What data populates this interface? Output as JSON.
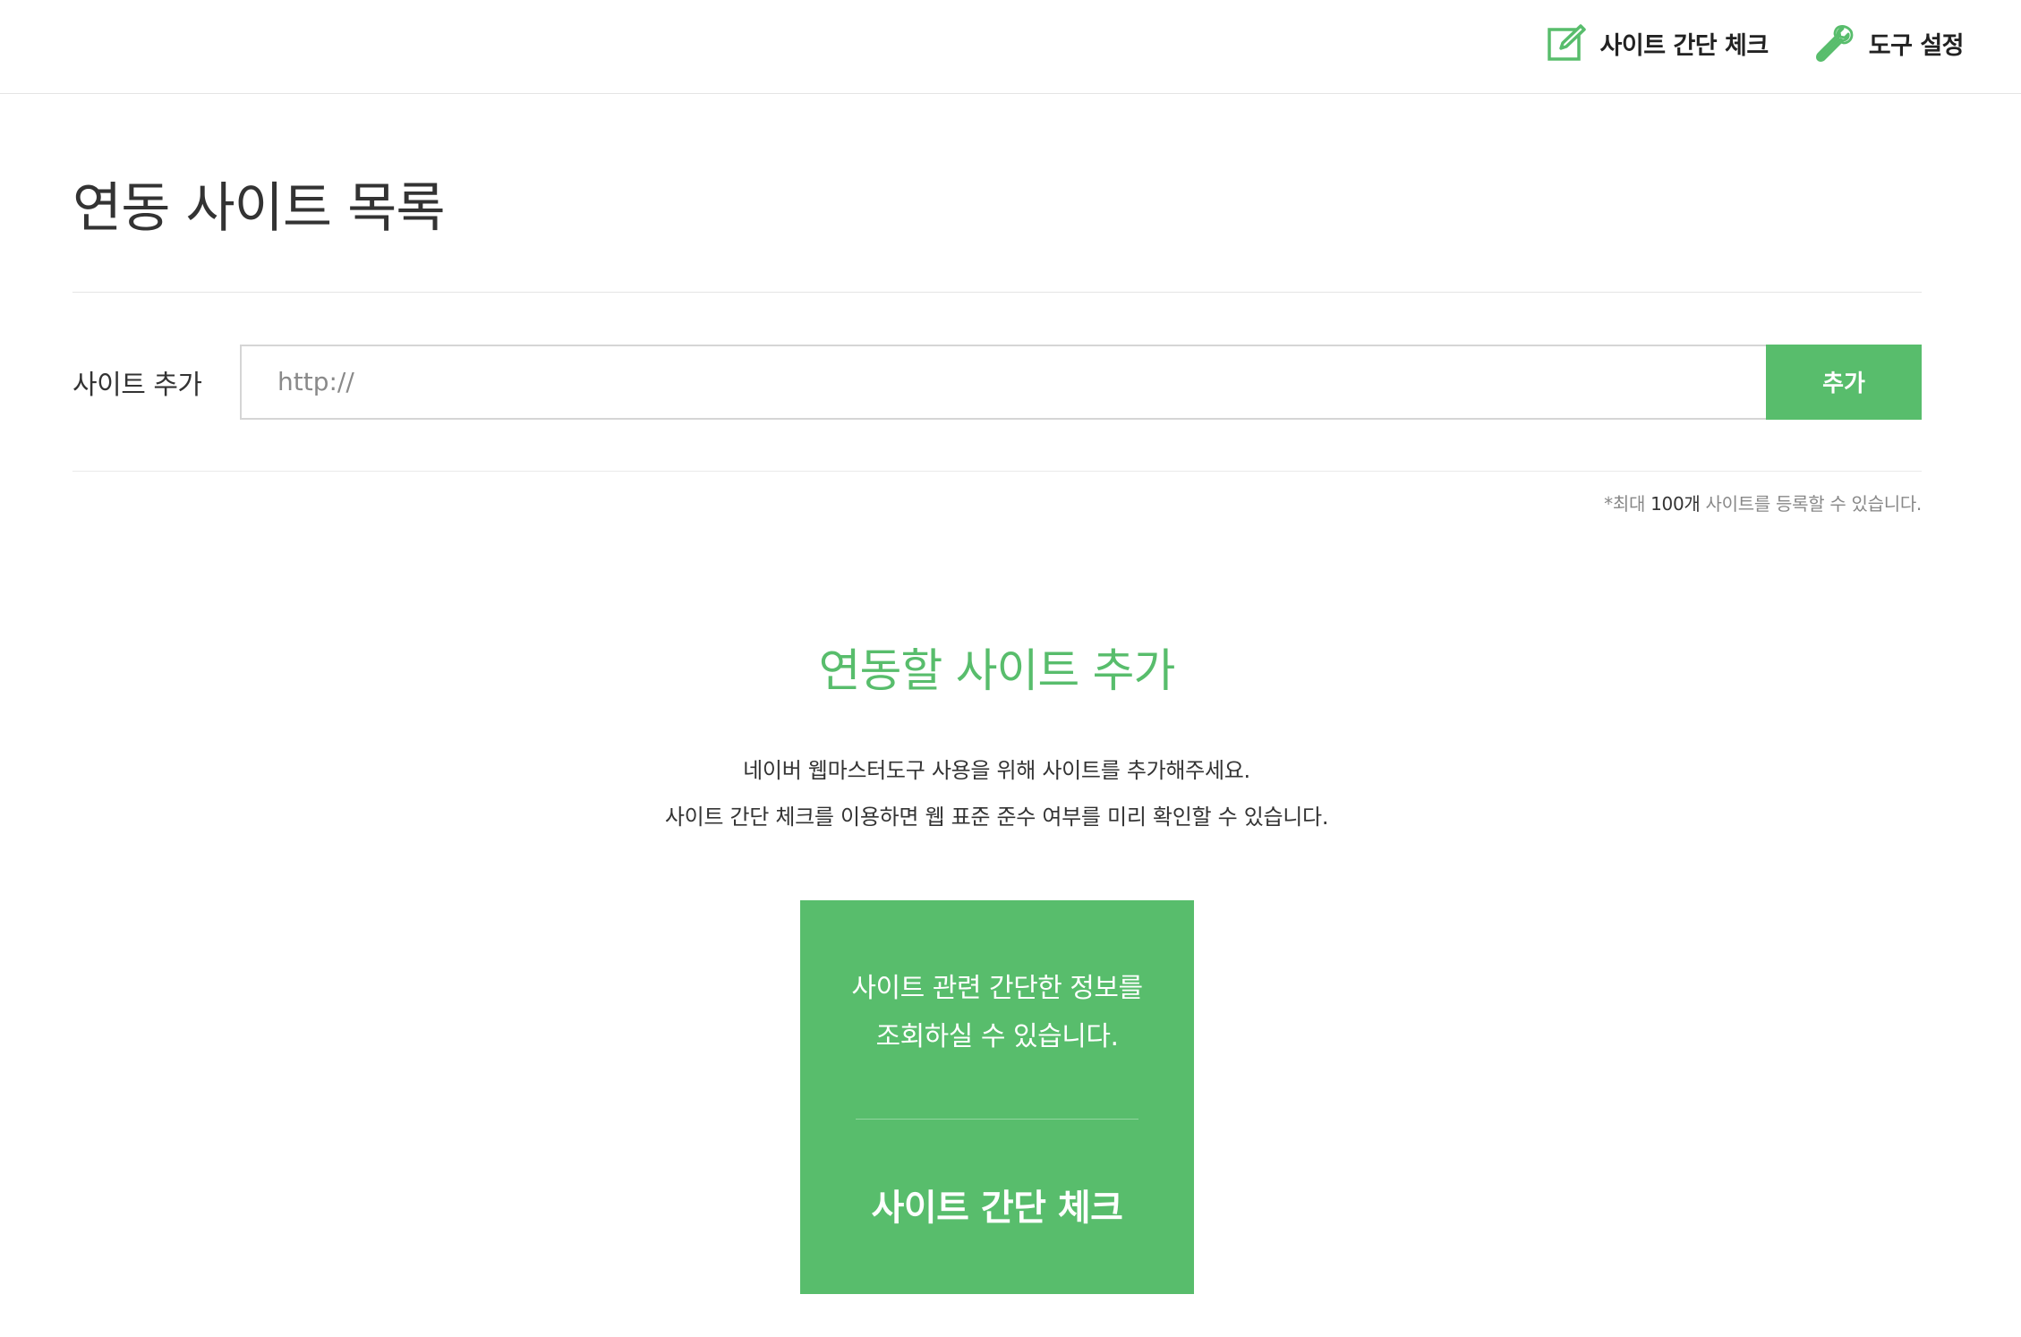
{
  "header": {
    "nav": [
      {
        "label": "사이트 간단 체크",
        "icon": "edit-icon"
      },
      {
        "label": "도구 설정",
        "icon": "wrench-icon"
      }
    ]
  },
  "main": {
    "title": "연동 사이트 목록",
    "add_site": {
      "label": "사이트 추가",
      "placeholder": "http://",
      "value": "",
      "button_label": "추가"
    },
    "note": {
      "prefix": "*최대 ",
      "number": "100개",
      "suffix": " 사이트를 등록할 수 있습니다."
    }
  },
  "intro": {
    "title": "연동할 사이트 추가",
    "desc_line1": "네이버 웹마스터도구 사용을 위해 사이트를 추가해주세요.",
    "desc_line2": "사이트 간단 체크를 이용하면 웹 표준 준수 여부를 미리 확인할 수 있습니다.",
    "card": {
      "text_line1": "사이트 관련 간단한 정보를",
      "text_line2": "조회하실 수 있습니다.",
      "action_label": "사이트 간단 체크"
    }
  },
  "colors": {
    "accent": "#58bd6c",
    "text": "#333333",
    "border": "#e4e4e4"
  }
}
